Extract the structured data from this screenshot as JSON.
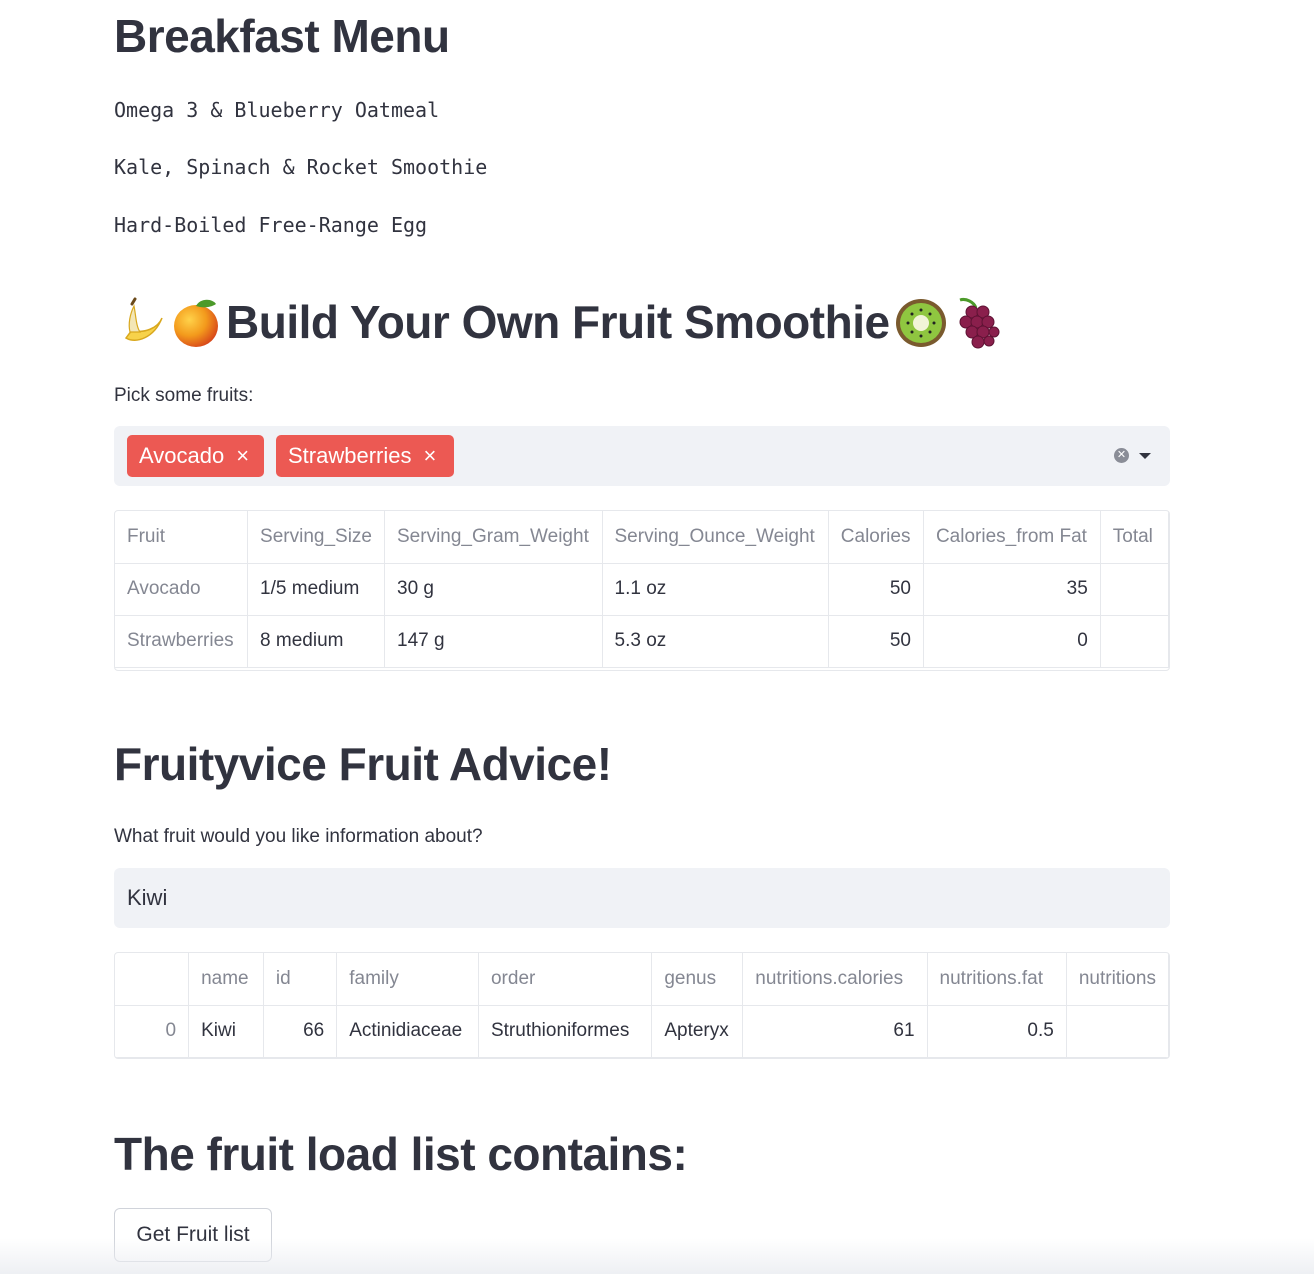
{
  "breakfast": {
    "title": "Breakfast Menu",
    "items": [
      "Omega 3 & Blueberry Oatmeal",
      "Kale, Spinach & Rocket Smoothie",
      "Hard-Boiled Free-Range Egg"
    ]
  },
  "smoothie": {
    "title": "Build Your Own Fruit Smoothie",
    "emoji_left": [
      "banana-emoji",
      "mango-emoji"
    ],
    "emoji_right": [
      "kiwi-emoji",
      "grapes-emoji"
    ],
    "picker_label": "Pick some fruits:",
    "selected": [
      "Avocado",
      "Strawberries"
    ],
    "chip_remove_glyph": "×",
    "chip_color": "#ec5953",
    "table": {
      "columns": [
        "Fruit",
        "Serving_Size",
        "Serving_Gram_Weight",
        "Serving_Ounce_Weight",
        "Calories",
        "Calories_from Fat",
        "Total"
      ],
      "rows": [
        [
          "Avocado",
          "1/5 medium",
          "30 g",
          "1.1 oz",
          "50",
          "35",
          ""
        ],
        [
          "Strawberries",
          "8 medium",
          "147 g",
          "5.3 oz",
          "50",
          "0",
          ""
        ]
      ]
    }
  },
  "advice": {
    "title": "Fruityvice Fruit Advice!",
    "input_label": "What fruit would you like information about?",
    "input_value": "Kiwi",
    "table": {
      "columns": [
        "",
        "name",
        "id",
        "family",
        "order",
        "genus",
        "nutritions.calories",
        "nutritions.fat",
        "nutritions"
      ],
      "rows": [
        [
          "0",
          "Kiwi",
          "66",
          "Actinidiaceae",
          "Struthioniformes",
          "Apteryx",
          "61",
          "0.5",
          ""
        ]
      ]
    }
  },
  "loadlist": {
    "title": "The fruit load list contains:",
    "button_label": "Get Fruit list"
  }
}
